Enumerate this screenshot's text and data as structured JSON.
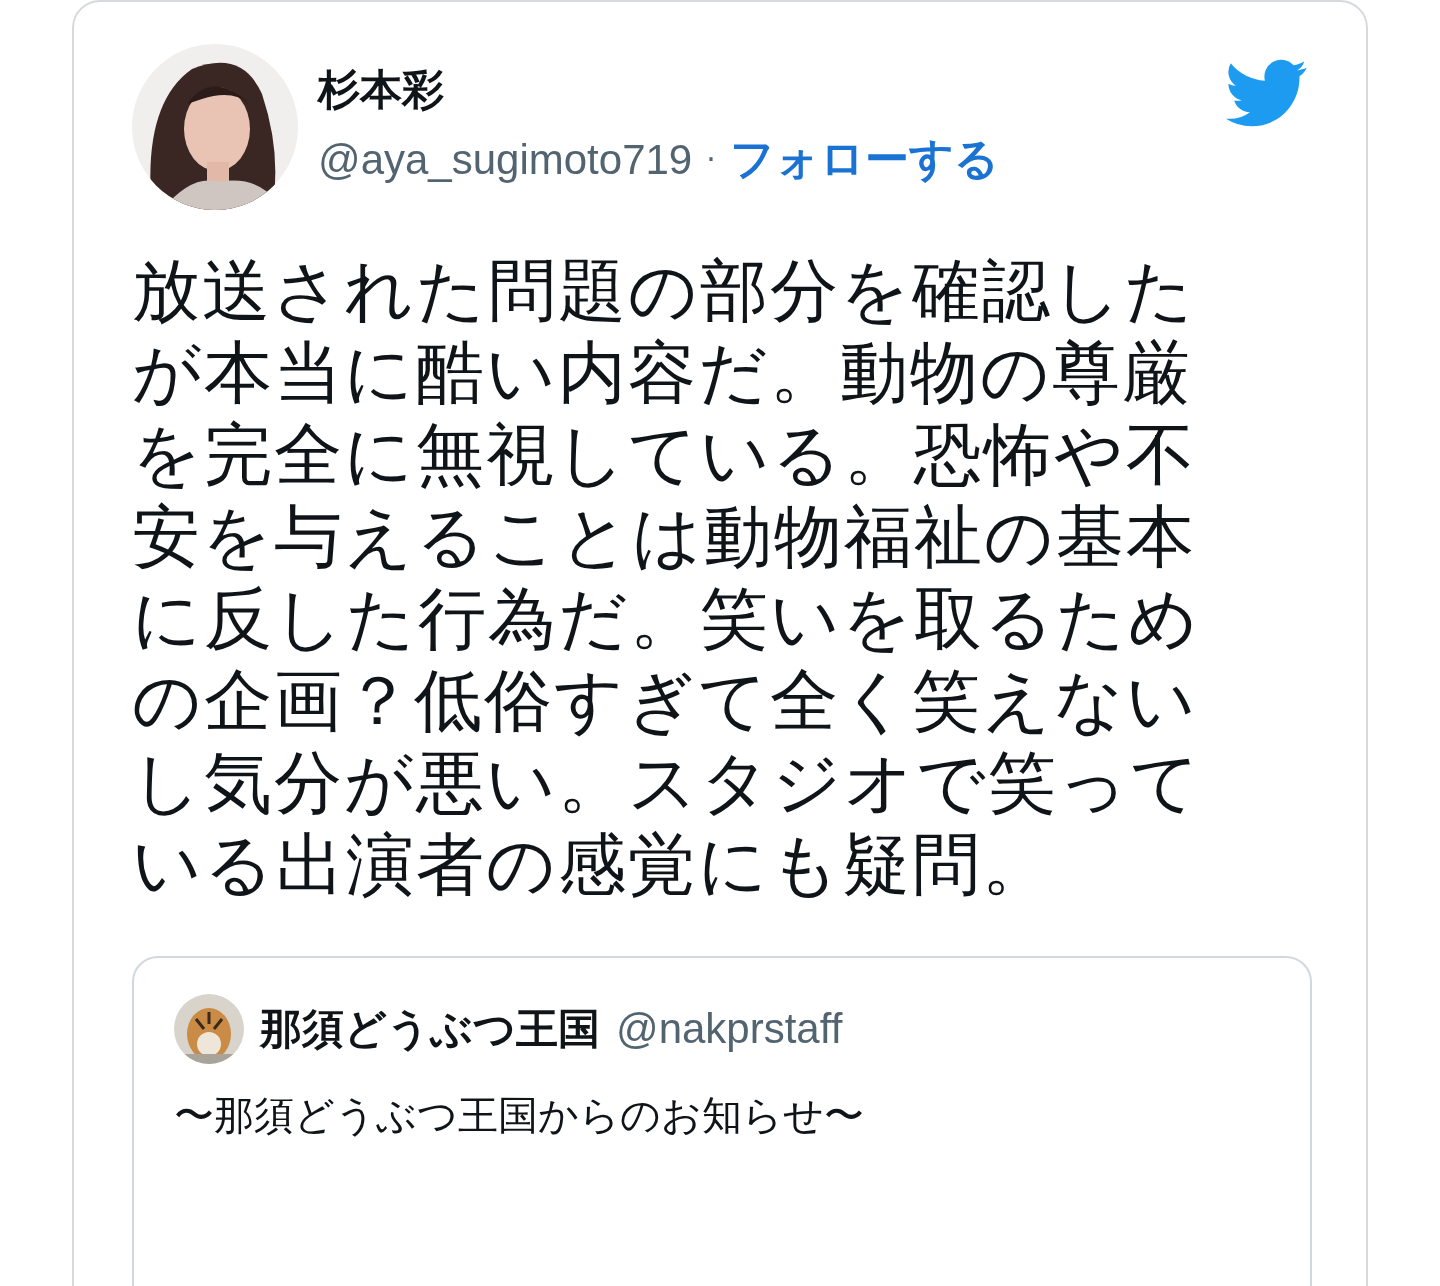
{
  "tweet": {
    "author": {
      "name": "杉本彩",
      "handle": "@aya_sugimoto719",
      "separator": "·",
      "follow_label": "フォローする"
    },
    "text": "放送された問題の部分を確認したが本当に酷い内容だ。動物の尊厳を完全に無視している。恐怖や不安を与えることは動物福祉の基本に反した行為だ。笑いを取るための企画？低俗すぎて全く笑えないし気分が悪い。スタジオで笑っている出演者の感覚にも疑問。",
    "quoted_tweet": {
      "name": "那須どうぶつ王国",
      "handle": "@nakprstaff",
      "text": "〜那須どうぶつ王国からのお知らせ〜"
    }
  }
}
